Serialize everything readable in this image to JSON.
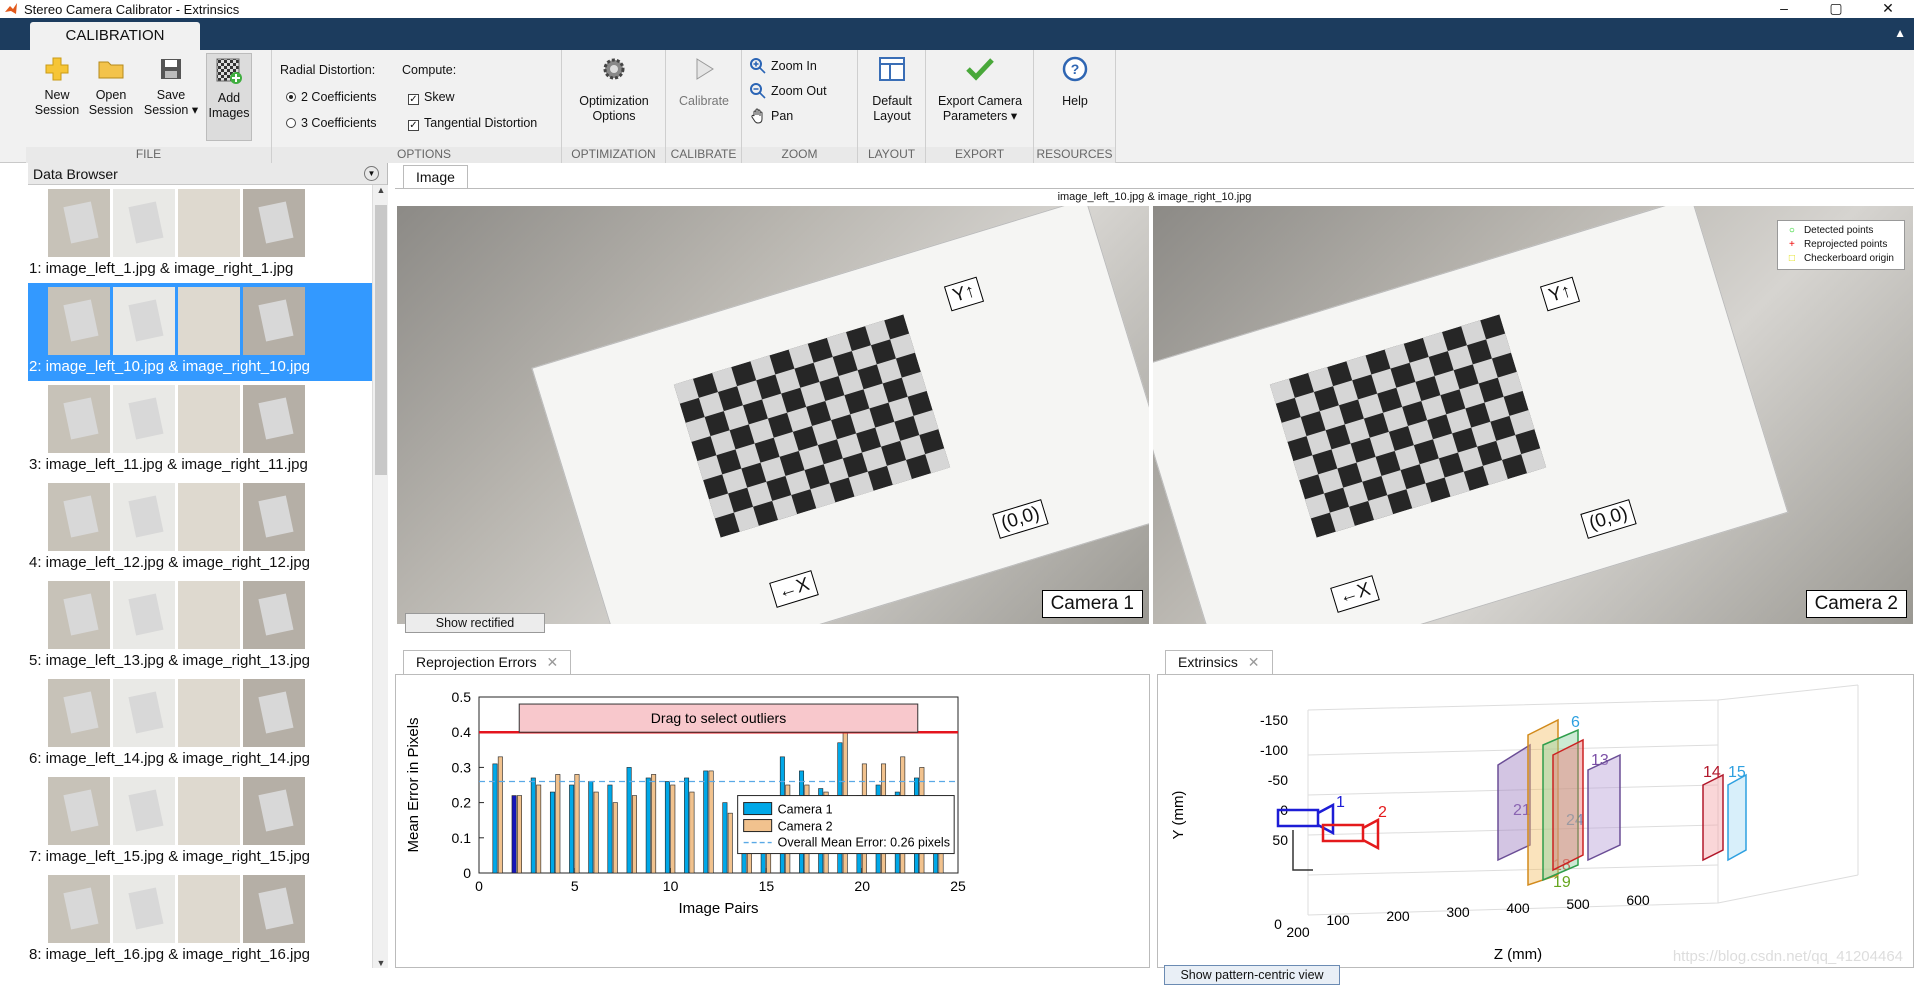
{
  "window": {
    "title": "Stereo Camera Calibrator - Extrinsics",
    "controls": [
      "–",
      "▢",
      "✕"
    ]
  },
  "ribbon_tab": "CALIBRATION",
  "ribbon": {
    "file": {
      "label": "FILE",
      "new": [
        "New",
        "Session"
      ],
      "open": [
        "Open",
        "Session"
      ],
      "save": [
        "Save",
        "Session ▾"
      ],
      "add": [
        "Add",
        "Images"
      ]
    },
    "options": {
      "label": "OPTIONS",
      "radial_label": "Radial Distortion:",
      "compute_label": "Compute:",
      "coef2": "2 Coefficients",
      "coef3": "3 Coefficients",
      "skew": "Skew",
      "tangential": "Tangential Distortion"
    },
    "optimization": {
      "label": "OPTIMIZATION",
      "button": [
        "Optimization",
        "Options"
      ]
    },
    "calibrate": {
      "label": "CALIBRATE",
      "button": "Calibrate"
    },
    "zoom": {
      "label": "ZOOM",
      "zoom_in": "Zoom In",
      "zoom_out": "Zoom Out",
      "pan": "Pan"
    },
    "layout": {
      "label": "LAYOUT",
      "button": [
        "Default",
        "Layout"
      ]
    },
    "export": {
      "label": "EXPORT",
      "button": [
        "Export Camera",
        "Parameters ▾"
      ]
    },
    "resources": {
      "label": "RESOURCES",
      "button": "Help"
    }
  },
  "browser": {
    "title": "Data Browser",
    "items": [
      "1: image_left_1.jpg & image_right_1.jpg",
      "2: image_left_10.jpg & image_right_10.jpg",
      "3: image_left_11.jpg & image_right_11.jpg",
      "4: image_left_12.jpg & image_right_12.jpg",
      "5: image_left_13.jpg & image_right_13.jpg",
      "6: image_left_14.jpg & image_right_14.jpg",
      "7: image_left_15.jpg & image_right_15.jpg",
      "8: image_left_16.jpg & image_right_16.jpg"
    ],
    "selected_index": 1
  },
  "image_panel": {
    "tab": "Image",
    "title": "image_left_10.jpg & image_right_10.jpg",
    "camera1": "Camera 1",
    "camera2": "Camera 2",
    "origin_tag": "(0,0)",
    "y_tag": "Y↑",
    "x_tag": "←X",
    "legend": [
      "Detected points",
      "Reprojected points",
      "Checkerboard origin"
    ],
    "show_rectified": "Show rectified"
  },
  "reprojection": {
    "tab": "Reprojection Errors",
    "drag_label": "Drag to select outliers",
    "legend": [
      "Camera 1",
      "Camera 2",
      "Overall Mean Error: 0.26 pixels"
    ]
  },
  "extrinsics": {
    "tab": "Extrinsics",
    "button": "Show pattern-centric view",
    "ylabel": "Y (mm)",
    "zlabel": "Z (mm)",
    "yticks": [
      "-150",
      "-100",
      "-50",
      "0",
      "50"
    ],
    "zticks": [
      "0",
      "100",
      "200",
      "300",
      "400",
      "500",
      "600"
    ],
    "depth_tick": "200",
    "watermark": "https://blog.csdn.net/qq_41204464"
  },
  "chart_data": {
    "type": "bar",
    "title": "",
    "xlabel": "Image Pairs",
    "ylabel": "Mean Error in Pixels",
    "xlim": [
      0,
      25
    ],
    "ylim": [
      0,
      0.5
    ],
    "xticks": [
      0,
      5,
      10,
      15,
      20,
      25
    ],
    "yticks": [
      0,
      0.1,
      0.2,
      0.3,
      0.4,
      0.5
    ],
    "categories": [
      1,
      2,
      3,
      4,
      5,
      6,
      7,
      8,
      9,
      10,
      11,
      12,
      13,
      14,
      15,
      16,
      17,
      18,
      19,
      20,
      21,
      22,
      23,
      24
    ],
    "series": [
      {
        "name": "Camera 1",
        "color": "#00a8e8",
        "values": [
          0.31,
          0.22,
          0.27,
          0.23,
          0.25,
          0.26,
          0.25,
          0.3,
          0.27,
          0.26,
          0.27,
          0.29,
          0.2,
          0.19,
          0.2,
          0.33,
          0.29,
          0.24,
          0.37,
          0.22,
          0.25,
          0.23,
          0.27,
          0.21
        ]
      },
      {
        "name": "Camera 2",
        "color": "#f1c28e",
        "values": [
          0.33,
          0.22,
          0.25,
          0.28,
          0.28,
          0.23,
          0.2,
          0.22,
          0.28,
          0.25,
          0.23,
          0.29,
          0.17,
          0.16,
          0.16,
          0.25,
          0.25,
          0.23,
          0.4,
          0.31,
          0.31,
          0.33,
          0.3,
          0.19
        ]
      }
    ],
    "highlight_index": 1,
    "highlight_color": "#1616b8",
    "overall_mean": 0.26,
    "threshold": 0.4,
    "threshold_color": "#e4141e",
    "legend_position": "bottom-right"
  }
}
